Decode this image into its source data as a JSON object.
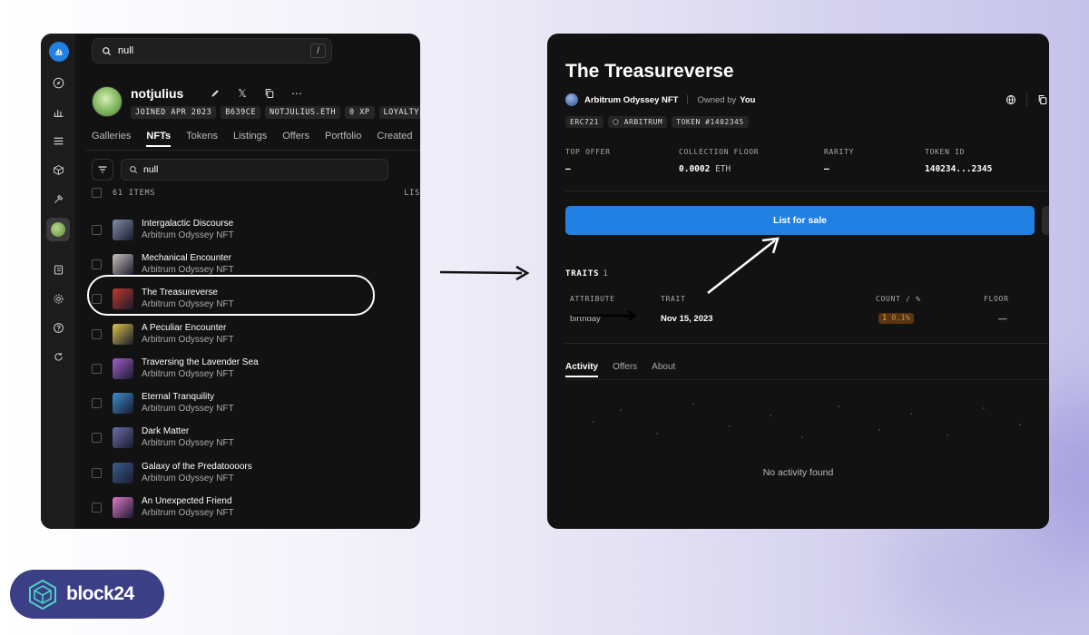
{
  "left_panel": {
    "search": {
      "value": "null",
      "shortcut": "/"
    },
    "profile": {
      "username": "notjulius",
      "badges": [
        "JOINED APR 2023",
        "B639CE",
        "NOTJULIUS.ETH",
        "0 XP",
        "LOYALTY"
      ]
    },
    "tabs": [
      "Galleries",
      "NFTs",
      "Tokens",
      "Listings",
      "Offers",
      "Portfolio",
      "Created"
    ],
    "active_tab": "NFTs",
    "filter_search": {
      "value": "null"
    },
    "items_count": "61 ITEMS",
    "list_header_right": "LIS",
    "nfts": [
      {
        "name": "Intergalactic Discourse",
        "collection": "Arbitrum Odyssey NFT",
        "color": "#7e8fa8"
      },
      {
        "name": "Mechanical Encounter",
        "collection": "Arbitrum Odyssey NFT",
        "color": "#c9c2bc"
      },
      {
        "name": "The Treasureverse",
        "collection": "Arbitrum Odyssey NFT",
        "color": "#c23a2c"
      },
      {
        "name": "A Peculiar Encounter",
        "collection": "Arbitrum Odyssey NFT",
        "color": "#d8c24a"
      },
      {
        "name": "Traversing the Lavender Sea",
        "collection": "Arbitrum Odyssey NFT",
        "color": "#a15fc9"
      },
      {
        "name": "Eternal Tranquility",
        "collection": "Arbitrum Odyssey NFT",
        "color": "#3b8fcf"
      },
      {
        "name": "Dark Matter",
        "collection": "Arbitrum Odyssey NFT",
        "color": "#6a6fa8"
      },
      {
        "name": "Galaxy of the Predatoooors",
        "collection": "Arbitrum Odyssey NFT",
        "color": "#3a5f8f"
      },
      {
        "name": "An Unexpected Friend",
        "collection": "Arbitrum Odyssey NFT",
        "color": "#e07ac6"
      }
    ],
    "highlighted_nft": "The Treasureverse"
  },
  "right_panel": {
    "title": "The Treasureverse",
    "collection": "Arbitrum Odyssey NFT",
    "owned_by_label": "Owned by",
    "owner": "You",
    "tags": [
      "ERC721",
      "ARBITRUM",
      "TOKEN #1402345"
    ],
    "stats": [
      {
        "label": "TOP OFFER",
        "value": "–",
        "unit": ""
      },
      {
        "label": "COLLECTION FLOOR",
        "value": "0.0002",
        "unit": "ETH"
      },
      {
        "label": "RARITY",
        "value": "–",
        "unit": ""
      },
      {
        "label": "TOKEN ID",
        "value": "140234...2345",
        "unit": ""
      }
    ],
    "list_button": "List for sale",
    "traits": {
      "heading": "TRAITS",
      "count": "1",
      "headers": [
        "ATTRIBUTE",
        "TRAIT",
        "COUNT / %",
        "FLOOR"
      ],
      "row": {
        "attribute": "birthday",
        "trait": "Nov 15, 2023",
        "count": "1",
        "percent": "0.1%",
        "floor": "—"
      }
    },
    "activity_tabs": [
      "Activity",
      "Offers",
      "About"
    ],
    "active_activity_tab": "Activity",
    "empty_state": "No activity found"
  },
  "brand": {
    "name": "block24"
  },
  "colors": {
    "accent_blue": "#2081e2",
    "panel_bg": "#121212",
    "brand_bg": "#3b3f86",
    "count_pill_bg": "#5a3510"
  }
}
